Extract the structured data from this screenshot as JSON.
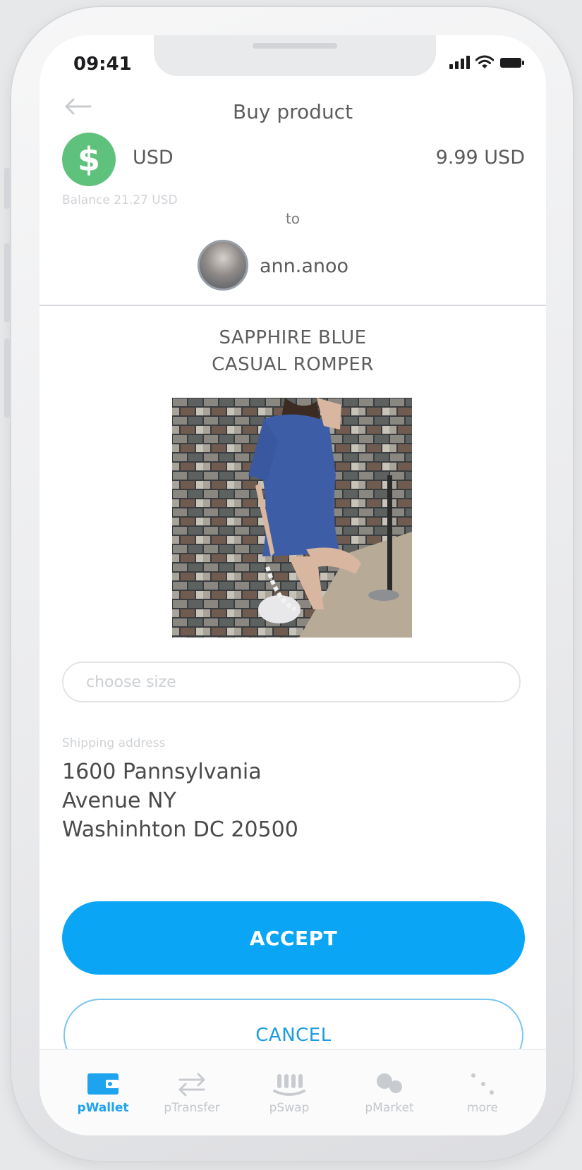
{
  "status_bar": {
    "time": "09:41"
  },
  "header": {
    "title": "Buy product"
  },
  "payment": {
    "currency_symbol": "$",
    "currency_code": "USD",
    "amount": "9.99 USD",
    "balance": "Balance 21.27 USD",
    "to_label": "to",
    "recipient": "ann.anoo"
  },
  "product": {
    "title_line1": "SAPPHIRE BLUE",
    "title_line2": "CASUAL ROMPER",
    "size_placeholder": "choose size"
  },
  "shipping": {
    "label": "Shipping address",
    "line1": "1600 Pannsylvania",
    "line2": "Avenue NY",
    "line3": "Washinhton DC 20500"
  },
  "actions": {
    "accept": "ACCEPT",
    "cancel": "CANCEL"
  },
  "tab_bar": {
    "items": [
      {
        "label": "pWallet",
        "icon": "wallet-icon",
        "active": true
      },
      {
        "label": "pTransfer",
        "icon": "transfer-arrows-icon",
        "active": false
      },
      {
        "label": "pSwap",
        "icon": "swap-icon",
        "active": false
      },
      {
        "label": "pMarket",
        "icon": "market-icon",
        "active": false
      },
      {
        "label": "more",
        "icon": "more-dots-icon",
        "active": false
      }
    ]
  },
  "colors": {
    "accent": "#0aa5f5",
    "currency_green": "#5ec27c",
    "active_tab": "#1ea3ee"
  }
}
